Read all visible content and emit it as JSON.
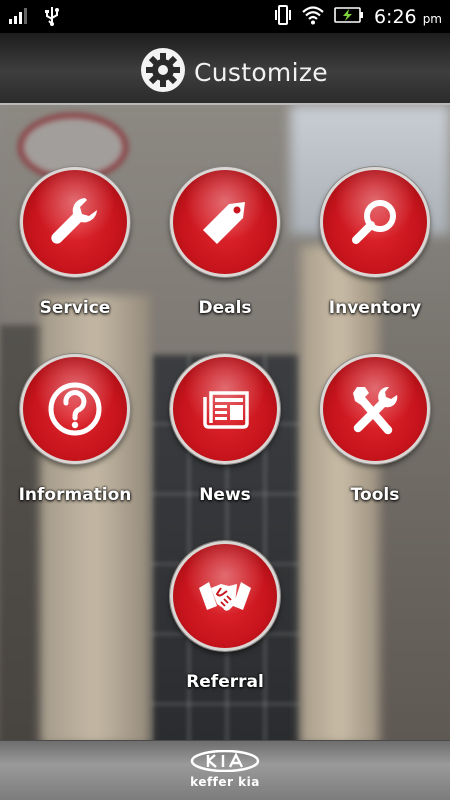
{
  "status_bar": {
    "time": "6:26",
    "ampm": "pm",
    "icons": [
      "signal-icon",
      "usb-icon",
      "vibrate-icon",
      "wifi-icon",
      "battery-charging-icon"
    ]
  },
  "header": {
    "title": "Customize",
    "icon": "gear-icon"
  },
  "menu": {
    "items": [
      {
        "label": "Service",
        "icon": "wrench-icon"
      },
      {
        "label": "Deals",
        "icon": "tag-icon"
      },
      {
        "label": "Inventory",
        "icon": "magnifier-icon"
      },
      {
        "label": "Information",
        "icon": "question-icon"
      },
      {
        "label": "News",
        "icon": "newspaper-icon"
      },
      {
        "label": "Tools",
        "icon": "tools-icon"
      },
      {
        "label": "Referral",
        "icon": "handshake-icon"
      }
    ]
  },
  "footer": {
    "brand_logo": "KIA",
    "dealer_name": "keffer kia"
  },
  "colors": {
    "accent_red": "#c8141c",
    "header_bg": "#2b2b2b",
    "footer_bg": "#8a8a8a"
  }
}
